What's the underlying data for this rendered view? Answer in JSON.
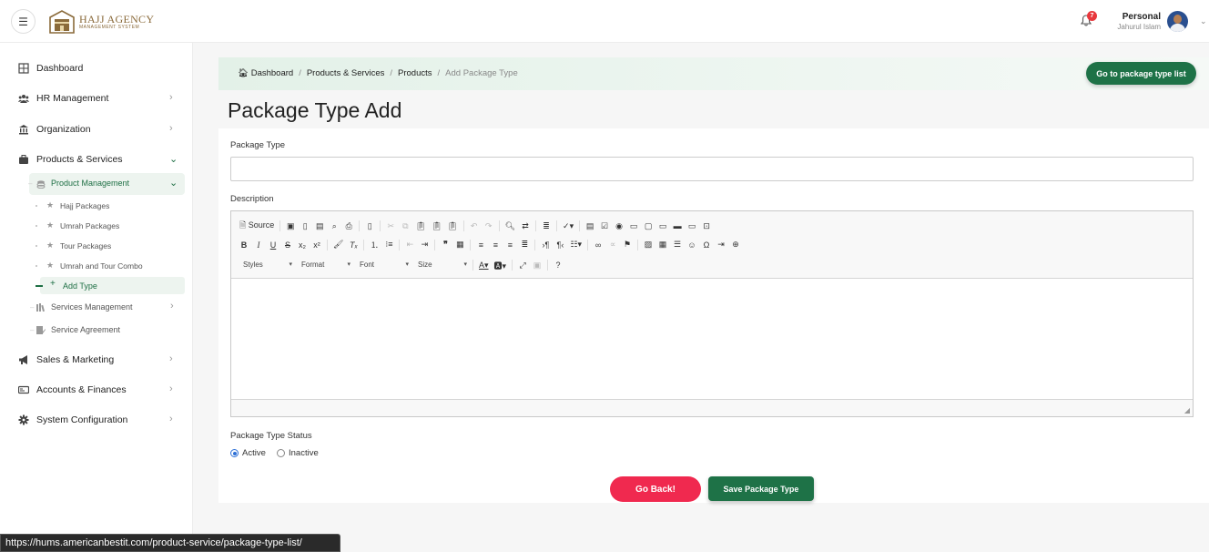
{
  "header": {
    "menu_icon": "hamburger-icon",
    "logo_title": "HAJJ AGENCY",
    "logo_subtitle": "MANAGEMENT SYSTEM",
    "notification_count": "7",
    "user_name": "Personal",
    "user_role": "Jahurul Islam"
  },
  "sidebar": {
    "items": [
      {
        "label": "Dashboard",
        "icon": "grid-icon"
      },
      {
        "label": "HR Management",
        "icon": "users-icon"
      },
      {
        "label": "Organization",
        "icon": "bank-icon"
      },
      {
        "label": "Products & Services",
        "icon": "briefcase-icon"
      },
      {
        "label": "Sales & Marketing",
        "icon": "megaphone-icon"
      },
      {
        "label": "Accounts & Finances",
        "icon": "money-icon"
      },
      {
        "label": "System Configuration",
        "icon": "gear-icon"
      }
    ],
    "product_management": "Product Management",
    "sub_items": [
      "Hajj Packages",
      "Umrah Packages",
      "Tour Packages",
      "Umrah and Tour Combo"
    ],
    "add_type": "Add Type",
    "services_management": "Services Management",
    "service_agreement": "Service Agreement"
  },
  "breadcrumb": {
    "items": [
      "Dashboard",
      "Products & Services",
      "Products"
    ],
    "current": "Add Package Type"
  },
  "go_button": "Go to package type list",
  "page_title": "Package Type Add",
  "form": {
    "package_type_label": "Package Type",
    "package_type_value": "",
    "description_label": "Description",
    "editor": {
      "source_label": "Source",
      "styles": "Styles",
      "format": "Format",
      "font": "Font",
      "size": "Size"
    },
    "status_label": "Package Type Status",
    "status_options": [
      "Active",
      "Inactive"
    ],
    "status_selected": "Active"
  },
  "buttons": {
    "go_back": "Go Back!",
    "save": "Save Package Type"
  },
  "status_url": "https://hums.americanbestit.com/product-service/package-type-list/",
  "colors": {
    "brand_green": "#1e7247",
    "danger": "#f0294f",
    "notification": "#e8383d"
  }
}
